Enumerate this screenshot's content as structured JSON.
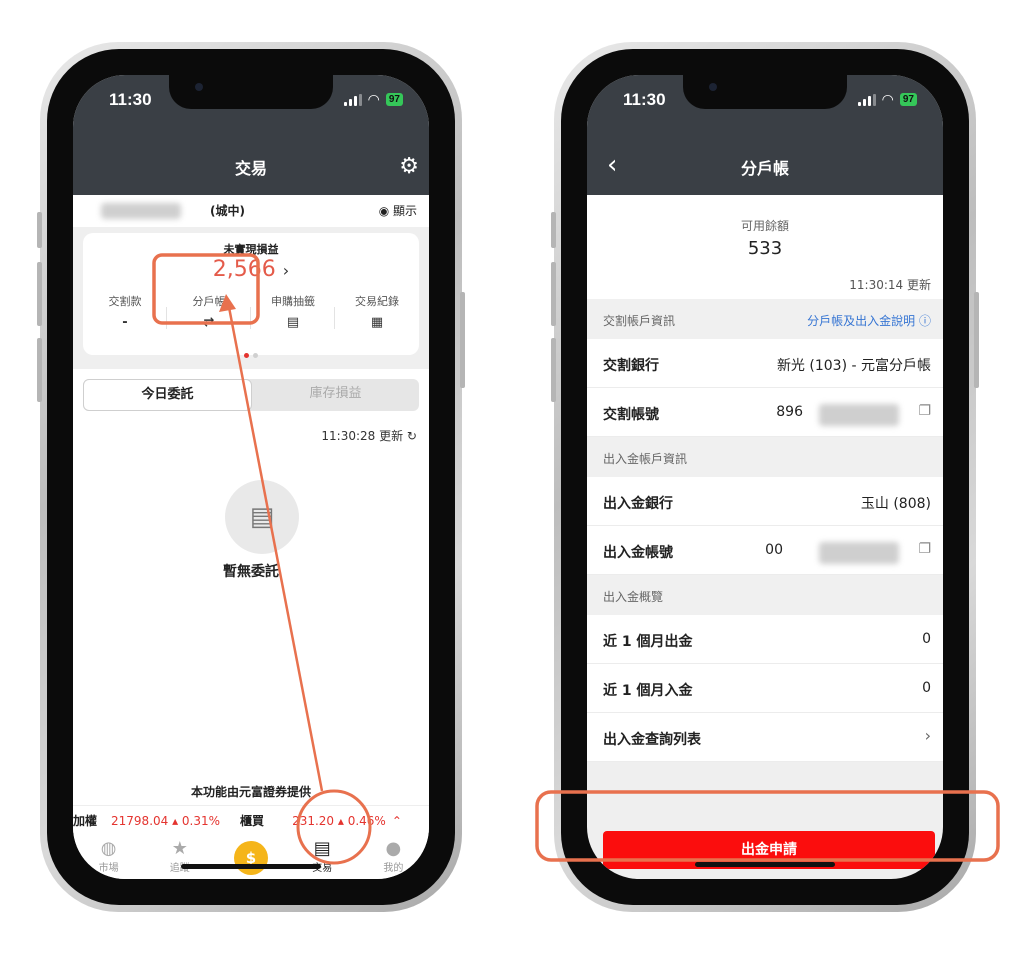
{
  "left": {
    "status": {
      "time": "11:30",
      "battery": "97"
    },
    "nav_title": "交易",
    "account": {
      "branch": "(城中)",
      "show_label": "◉ 顯示"
    },
    "unrealized": {
      "label": "未實現損益",
      "value": "2,566",
      "arrow": "›"
    },
    "quick": [
      {
        "label": "交割款",
        "value": "-"
      },
      {
        "label": "分戶帳",
        "value": "⇄"
      },
      {
        "label": "申購抽籤",
        "value": "▤"
      },
      {
        "label": "交易紀錄",
        "value": "▦"
      }
    ],
    "segments": {
      "active": "今日委託",
      "inactive": "庫存損益"
    },
    "update_time": "11:30:28 更新 ↻",
    "empty_text": "暫無委託",
    "provider_note": "本功能由元富證券提供",
    "ticker": {
      "name1": "加權",
      "value1": "21798.04 ▴ 0.31%",
      "name2": "櫃買",
      "value2": "231.20 ▴ 0.46%",
      "chevron": "⌃"
    },
    "tabs": [
      {
        "label": "市場",
        "icon": "compass-icon",
        "glyph": "◍"
      },
      {
        "label": "追蹤",
        "icon": "star-icon",
        "glyph": "★"
      },
      {
        "label": "",
        "icon": "coin-icon",
        "glyph": "$"
      },
      {
        "label": "交易",
        "icon": "document-icon",
        "glyph": "▤"
      },
      {
        "label": "我的",
        "icon": "person-icon",
        "glyph": "●"
      }
    ]
  },
  "right": {
    "status": {
      "time": "11:30",
      "battery": "97"
    },
    "nav_title": "分戶帳",
    "balance": {
      "label": "可用餘額",
      "value": "533",
      "updated": "11:30:14 更新"
    },
    "sections": {
      "settlement": {
        "title": "交割帳戶資訊",
        "link": "分戶帳及出入金說明 ⓘ"
      },
      "transfer": {
        "title": "出入金帳戶資訊"
      },
      "overview": {
        "title": "出入金概覽"
      }
    },
    "rows": {
      "settle_bank": {
        "label": "交割銀行",
        "value": "新光 (103) - 元富分戶帳"
      },
      "settle_account": {
        "label": "交割帳號",
        "value": "896"
      },
      "transfer_bank": {
        "label": "出入金銀行",
        "value": "玉山 (808)"
      },
      "transfer_account": {
        "label": "出入金帳號",
        "value": "00"
      },
      "out_month": {
        "label": "近 1 個月出金",
        "value": "0"
      },
      "in_month": {
        "label": "近 1 個月入金",
        "value": "0"
      },
      "query_list": {
        "label": "出入金查詢列表",
        "value": "›"
      }
    },
    "withdraw_button": "出金申請"
  },
  "colors": {
    "header": "#3a3f45",
    "accent_red": "#fb0d0d",
    "highlight": "#e8714e",
    "link": "#3675d3"
  }
}
